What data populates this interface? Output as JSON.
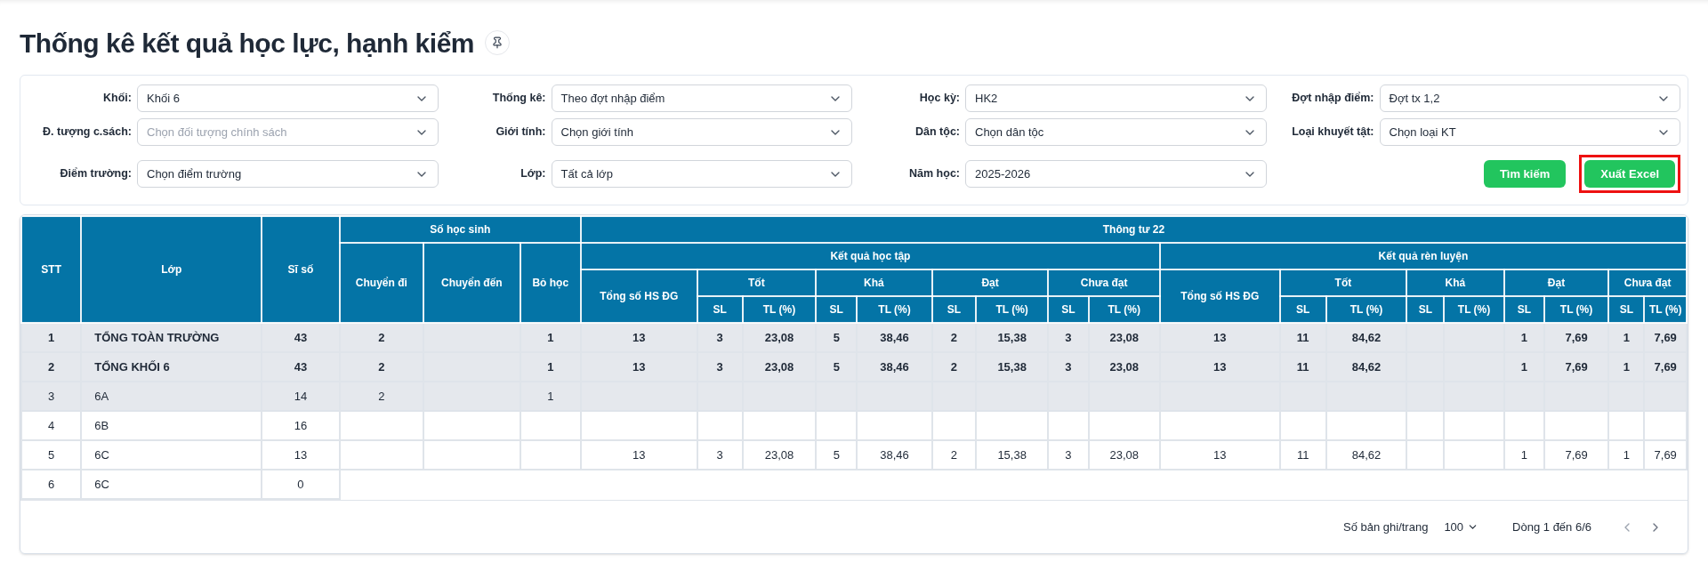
{
  "title": "Thống kê kết quả học lực, hạnh kiểm",
  "filters": [
    {
      "label": "Khối:",
      "value": "Khối 6"
    },
    {
      "label": "Thống kê:",
      "value": "Theo đợt nhập điểm"
    },
    {
      "label": "Học kỳ:",
      "value": "HK2"
    },
    {
      "label": "Đợt nhập điểm:",
      "value": "Đợt tx 1,2"
    },
    {
      "label": "Đ. tượng c.sách:",
      "placeholder": "Chọn đối tượng chính sách"
    },
    {
      "label": "Giới tính:",
      "value": "Chọn giới tính"
    },
    {
      "label": "Dân tộc:",
      "value": "Chọn dân tộc"
    },
    {
      "label": "Loại khuyết tật:",
      "value": "Chọn loại KT"
    },
    {
      "label": "Điểm trường:",
      "value": "Chọn điểm trường"
    },
    {
      "label": "Lớp:",
      "value": "Tất cả lớp"
    },
    {
      "label": "Năm học:",
      "value": "2025-2026"
    }
  ],
  "buttons": [
    {
      "label": "Tìm kiếm",
      "outlined": false
    },
    {
      "label": "Xuất Excel",
      "outlined": true
    }
  ],
  "table": {
    "headers": [
      {
        "label": "STT"
      },
      {
        "label": "Lớp"
      },
      {
        "label": "Sĩ số"
      },
      {
        "label": "Số học sinh",
        "children": [
          {
            "label": "Chuyển đi"
          },
          {
            "label": "Chuyển đến"
          },
          {
            "label": "Bỏ học"
          }
        ]
      },
      {
        "label": "Thông tư 22",
        "children": [
          {
            "label": "Kết quả học tập",
            "children": [
              {
                "label": "Tổng số HS ĐG"
              },
              {
                "label": "Tốt",
                "children": [
                  {
                    "label": "SL"
                  },
                  {
                    "label": "TL (%)"
                  }
                ]
              },
              {
                "label": "Khá",
                "children": [
                  {
                    "label": "SL"
                  },
                  {
                    "label": "TL (%)"
                  }
                ]
              },
              {
                "label": "Đạt",
                "children": [
                  {
                    "label": "SL"
                  },
                  {
                    "label": "TL (%)"
                  }
                ]
              },
              {
                "label": "Chưa đạt",
                "children": [
                  {
                    "label": "SL"
                  },
                  {
                    "label": "TL (%)"
                  }
                ]
              }
            ]
          },
          {
            "label": "Kết quả rèn luyện",
            "children": [
              {
                "label": "Tổng số HS ĐG"
              },
              {
                "label": "Tốt",
                "children": [
                  {
                    "label": "SL"
                  },
                  {
                    "label": "TL (%)"
                  }
                ]
              },
              {
                "label": "Khá",
                "children": [
                  {
                    "label": "SL"
                  },
                  {
                    "label": "TL (%)"
                  }
                ]
              },
              {
                "label": "Đạt",
                "children": [
                  {
                    "label": "SL"
                  },
                  {
                    "label": "TL (%)"
                  }
                ]
              },
              {
                "label": "Chưa đạt",
                "children": [
                  {
                    "label": "SL"
                  },
                  {
                    "label": "TL (%)"
                  }
                ]
              }
            ]
          }
        ]
      }
    ],
    "rows": [
      {
        "bold": true,
        "shaded": true,
        "cells": [
          "1",
          "TỔNG TOÀN TRƯỜNG",
          "43",
          "2",
          null,
          "1",
          "13",
          "3",
          "23,08",
          "5",
          "38,46",
          "2",
          "15,38",
          "3",
          "23,08",
          "13",
          "11",
          "84,62",
          null,
          null,
          "1",
          "7,69",
          "1",
          "7,69"
        ]
      },
      {
        "bold": true,
        "shaded": true,
        "cells": [
          "2",
          "TỔNG KHỐI 6",
          "43",
          "2",
          null,
          "1",
          "13",
          "3",
          "23,08",
          "5",
          "38,46",
          "2",
          "15,38",
          "3",
          "23,08",
          "13",
          "11",
          "84,62",
          null,
          null,
          "1",
          "7,69",
          "1",
          "7,69"
        ]
      },
      {
        "bold": false,
        "shaded": true,
        "cells": [
          "3",
          "6A",
          "14",
          "2",
          null,
          "1",
          null,
          null,
          null,
          null,
          null,
          null,
          null,
          null,
          null,
          null,
          null,
          null,
          null,
          null,
          null,
          null,
          null,
          null
        ]
      },
      {
        "bold": false,
        "shaded": false,
        "cells": [
          "4",
          "6B",
          "16",
          null,
          null,
          null,
          null,
          null,
          null,
          null,
          null,
          null,
          null,
          null,
          null,
          null,
          null,
          null,
          null,
          null,
          null,
          null,
          null,
          null
        ]
      },
      {
        "bold": false,
        "shaded": false,
        "cells": [
          "5",
          "6C",
          "13",
          null,
          null,
          null,
          "13",
          "3",
          "23,08",
          "5",
          "38,46",
          "2",
          "15,38",
          "3",
          "23,08",
          "13",
          "11",
          "84,62",
          null,
          null,
          "1",
          "7,69",
          "1",
          "7,69"
        ]
      },
      {
        "bold": false,
        "shaded": false,
        "cells": [
          "6",
          "6C",
          "0"
        ]
      }
    ]
  },
  "pagination": {
    "page_size_label": "Số bản ghi/trang",
    "page_size": "100",
    "range": "Dòng 1 đến 6/6"
  }
}
